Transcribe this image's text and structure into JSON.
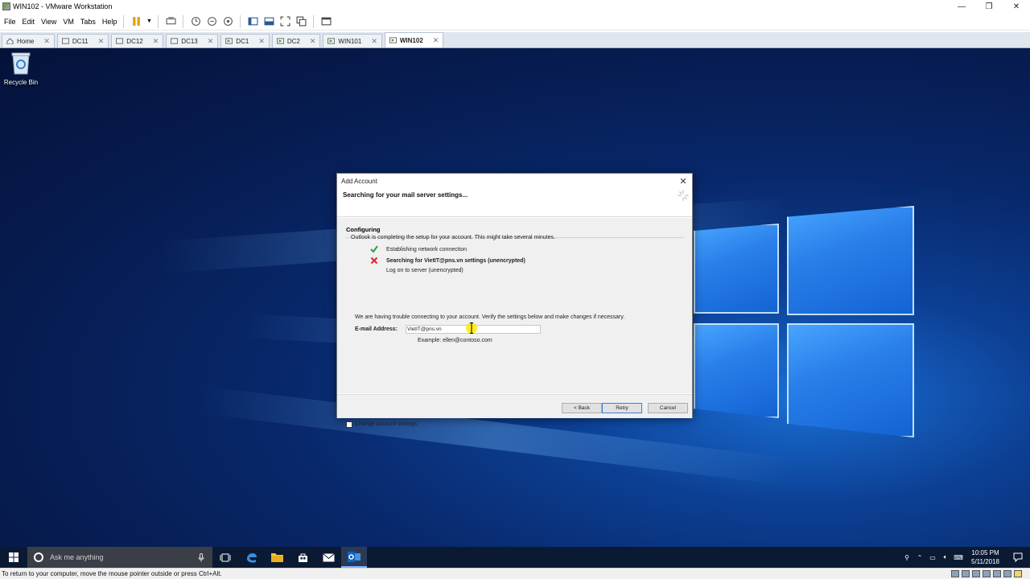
{
  "window": {
    "title": "WIN102 - VMware Workstation"
  },
  "menu": [
    "File",
    "Edit",
    "View",
    "VM",
    "Tabs",
    "Help"
  ],
  "tabs": [
    {
      "label": "Home",
      "active": false
    },
    {
      "label": "DC11",
      "active": false
    },
    {
      "label": "DC12",
      "active": false
    },
    {
      "label": "DC13",
      "active": false
    },
    {
      "label": "DC1",
      "active": false
    },
    {
      "label": "DC2",
      "active": false
    },
    {
      "label": "WIN101",
      "active": false
    },
    {
      "label": "WIN102",
      "active": true
    }
  ],
  "desktop": {
    "recycle_bin": "Recycle Bin"
  },
  "dialog": {
    "title": "Add Account",
    "header": "Searching for your mail server settings...",
    "section": "Configuring",
    "intro": "Outlook is completing the setup for your account. This might take several minutes.",
    "steps": [
      {
        "label": "Establishing network connection",
        "status": "done"
      },
      {
        "label": "Searching for VietIT@pns.vn settings (unencrypted)",
        "status": "failed"
      },
      {
        "label": "Log on to server (unencrypted)",
        "status": "pending"
      }
    ],
    "trouble": "We are having trouble connecting to your account. Verify the settings below and make changes if necessary.",
    "email_label": "E-mail Address:",
    "email_value": "VietIT@pns.vn",
    "example": "Example: ellen@contoso.com",
    "change_settings": "Change account settings",
    "back_label": "< Back",
    "retry_label": "Retry",
    "cancel_label": "Cancel"
  },
  "taskbar": {
    "search_placeholder": "Ask me anything",
    "time": "10:05 PM",
    "date": "5/11/2018"
  },
  "statusbar": {
    "text": "To return to your computer, move the mouse pointer outside or press Ctrl+Alt."
  },
  "colors": {
    "accent": "#0078d7",
    "check_green": "#2e9e3a",
    "x_red": "#d8262b",
    "taskbar": "#0b1a33"
  }
}
